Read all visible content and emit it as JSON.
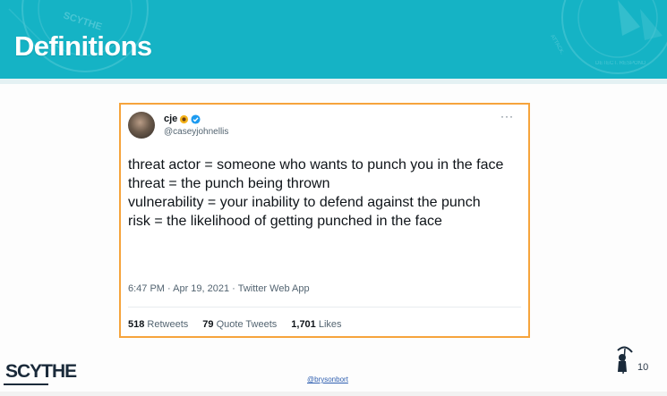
{
  "slide": {
    "title": "Definitions",
    "banner_color": "#15b3c5",
    "accent_border_color": "#f6a43c",
    "banner_decor_left_text": "SCYTHE",
    "banner_decor_right_text": "ATTACK. DETECT. RESPOND"
  },
  "tweet": {
    "display_name": "cje",
    "emoji": "sunflower",
    "verified": true,
    "handle": "@caseyjohnellis",
    "more_label": "···",
    "lines": [
      "threat actor = someone who wants to punch you in the face",
      "threat = the punch being thrown",
      "vulnerability = your inability to defend against the punch",
      "risk = the likelihood of getting punched in the face"
    ],
    "meta": "6:47 PM · Apr 19, 2021 · Twitter Web App",
    "stats": {
      "retweets_count": "518",
      "retweets_label": "Retweets",
      "quote_count": "79",
      "quote_label": "Quote Tweets",
      "likes_count": "1,701",
      "likes_label": "Likes"
    }
  },
  "footer": {
    "logo_text": "SCYTHE",
    "link_text": "@brysonbort",
    "page_number": "10"
  }
}
